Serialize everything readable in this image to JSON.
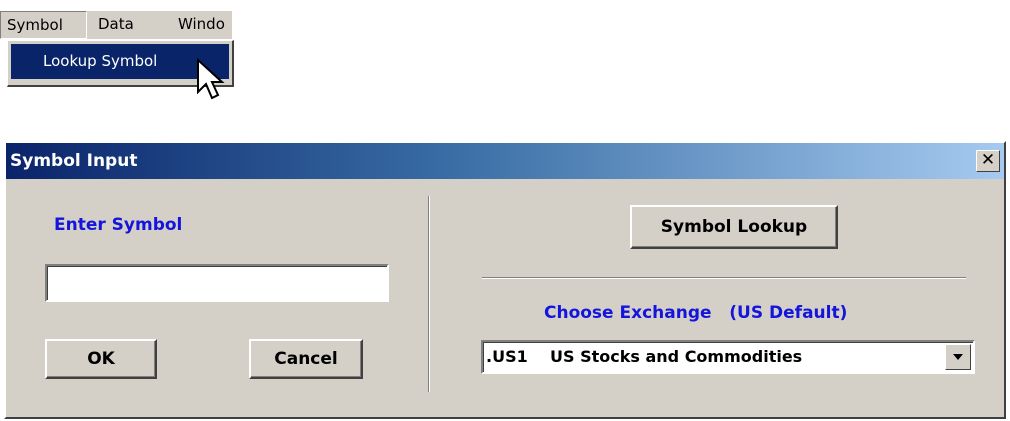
{
  "menubar": {
    "items": [
      {
        "label": "Symbol"
      },
      {
        "label": "Data"
      },
      {
        "label": "Windo"
      }
    ],
    "dropdown": {
      "items": [
        {
          "label": "Lookup Symbol"
        }
      ]
    }
  },
  "dialog": {
    "title": "Symbol Input",
    "close_label": "x",
    "enter_symbol_label": "Enter Symbol",
    "symbol_input_value": "",
    "ok_label": "OK",
    "cancel_label": "Cancel",
    "symbol_lookup_label": "Symbol Lookup",
    "choose_exchange_label": "Choose Exchange   (US Default)",
    "exchange_selected": ".US1    US Stocks and Commodities"
  },
  "colors": {
    "face": "#d4d0c8",
    "highlight": "#0a246a",
    "label_blue": "#1414dc"
  }
}
